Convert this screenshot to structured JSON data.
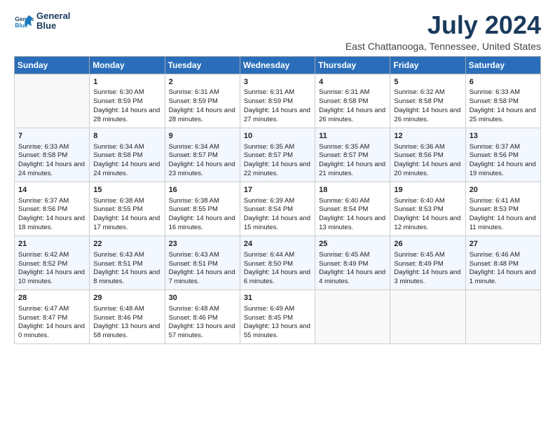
{
  "logo": {
    "line1": "General",
    "line2": "Blue"
  },
  "title": "July 2024",
  "subtitle": "East Chattanooga, Tennessee, United States",
  "days_of_week": [
    "Sunday",
    "Monday",
    "Tuesday",
    "Wednesday",
    "Thursday",
    "Friday",
    "Saturday"
  ],
  "weeks": [
    [
      {
        "num": "",
        "sunrise": "",
        "sunset": "",
        "daylight": "",
        "empty": true
      },
      {
        "num": "1",
        "sunrise": "Sunrise: 6:30 AM",
        "sunset": "Sunset: 8:59 PM",
        "daylight": "Daylight: 14 hours and 28 minutes."
      },
      {
        "num": "2",
        "sunrise": "Sunrise: 6:31 AM",
        "sunset": "Sunset: 8:59 PM",
        "daylight": "Daylight: 14 hours and 28 minutes."
      },
      {
        "num": "3",
        "sunrise": "Sunrise: 6:31 AM",
        "sunset": "Sunset: 8:59 PM",
        "daylight": "Daylight: 14 hours and 27 minutes."
      },
      {
        "num": "4",
        "sunrise": "Sunrise: 6:31 AM",
        "sunset": "Sunset: 8:58 PM",
        "daylight": "Daylight: 14 hours and 26 minutes."
      },
      {
        "num": "5",
        "sunrise": "Sunrise: 6:32 AM",
        "sunset": "Sunset: 8:58 PM",
        "daylight": "Daylight: 14 hours and 26 minutes."
      },
      {
        "num": "6",
        "sunrise": "Sunrise: 6:33 AM",
        "sunset": "Sunset: 8:58 PM",
        "daylight": "Daylight: 14 hours and 25 minutes."
      }
    ],
    [
      {
        "num": "7",
        "sunrise": "Sunrise: 6:33 AM",
        "sunset": "Sunset: 8:58 PM",
        "daylight": "Daylight: 14 hours and 24 minutes."
      },
      {
        "num": "8",
        "sunrise": "Sunrise: 6:34 AM",
        "sunset": "Sunset: 8:58 PM",
        "daylight": "Daylight: 14 hours and 24 minutes."
      },
      {
        "num": "9",
        "sunrise": "Sunrise: 6:34 AM",
        "sunset": "Sunset: 8:57 PM",
        "daylight": "Daylight: 14 hours and 23 minutes."
      },
      {
        "num": "10",
        "sunrise": "Sunrise: 6:35 AM",
        "sunset": "Sunset: 8:57 PM",
        "daylight": "Daylight: 14 hours and 22 minutes."
      },
      {
        "num": "11",
        "sunrise": "Sunrise: 6:35 AM",
        "sunset": "Sunset: 8:57 PM",
        "daylight": "Daylight: 14 hours and 21 minutes."
      },
      {
        "num": "12",
        "sunrise": "Sunrise: 6:36 AM",
        "sunset": "Sunset: 8:56 PM",
        "daylight": "Daylight: 14 hours and 20 minutes."
      },
      {
        "num": "13",
        "sunrise": "Sunrise: 6:37 AM",
        "sunset": "Sunset: 8:56 PM",
        "daylight": "Daylight: 14 hours and 19 minutes."
      }
    ],
    [
      {
        "num": "14",
        "sunrise": "Sunrise: 6:37 AM",
        "sunset": "Sunset: 8:56 PM",
        "daylight": "Daylight: 14 hours and 18 minutes."
      },
      {
        "num": "15",
        "sunrise": "Sunrise: 6:38 AM",
        "sunset": "Sunset: 8:55 PM",
        "daylight": "Daylight: 14 hours and 17 minutes."
      },
      {
        "num": "16",
        "sunrise": "Sunrise: 6:38 AM",
        "sunset": "Sunset: 8:55 PM",
        "daylight": "Daylight: 14 hours and 16 minutes."
      },
      {
        "num": "17",
        "sunrise": "Sunrise: 6:39 AM",
        "sunset": "Sunset: 8:54 PM",
        "daylight": "Daylight: 14 hours and 15 minutes."
      },
      {
        "num": "18",
        "sunrise": "Sunrise: 6:40 AM",
        "sunset": "Sunset: 8:54 PM",
        "daylight": "Daylight: 14 hours and 13 minutes."
      },
      {
        "num": "19",
        "sunrise": "Sunrise: 6:40 AM",
        "sunset": "Sunset: 8:53 PM",
        "daylight": "Daylight: 14 hours and 12 minutes."
      },
      {
        "num": "20",
        "sunrise": "Sunrise: 6:41 AM",
        "sunset": "Sunset: 8:53 PM",
        "daylight": "Daylight: 14 hours and 11 minutes."
      }
    ],
    [
      {
        "num": "21",
        "sunrise": "Sunrise: 6:42 AM",
        "sunset": "Sunset: 8:52 PM",
        "daylight": "Daylight: 14 hours and 10 minutes."
      },
      {
        "num": "22",
        "sunrise": "Sunrise: 6:43 AM",
        "sunset": "Sunset: 8:51 PM",
        "daylight": "Daylight: 14 hours and 8 minutes."
      },
      {
        "num": "23",
        "sunrise": "Sunrise: 6:43 AM",
        "sunset": "Sunset: 8:51 PM",
        "daylight": "Daylight: 14 hours and 7 minutes."
      },
      {
        "num": "24",
        "sunrise": "Sunrise: 6:44 AM",
        "sunset": "Sunset: 8:50 PM",
        "daylight": "Daylight: 14 hours and 6 minutes."
      },
      {
        "num": "25",
        "sunrise": "Sunrise: 6:45 AM",
        "sunset": "Sunset: 8:49 PM",
        "daylight": "Daylight: 14 hours and 4 minutes."
      },
      {
        "num": "26",
        "sunrise": "Sunrise: 6:45 AM",
        "sunset": "Sunset: 8:49 PM",
        "daylight": "Daylight: 14 hours and 3 minutes."
      },
      {
        "num": "27",
        "sunrise": "Sunrise: 6:46 AM",
        "sunset": "Sunset: 8:48 PM",
        "daylight": "Daylight: 14 hours and 1 minute."
      }
    ],
    [
      {
        "num": "28",
        "sunrise": "Sunrise: 6:47 AM",
        "sunset": "Sunset: 8:47 PM",
        "daylight": "Daylight: 14 hours and 0 minutes."
      },
      {
        "num": "29",
        "sunrise": "Sunrise: 6:48 AM",
        "sunset": "Sunset: 8:46 PM",
        "daylight": "Daylight: 13 hours and 58 minutes."
      },
      {
        "num": "30",
        "sunrise": "Sunrise: 6:48 AM",
        "sunset": "Sunset: 8:46 PM",
        "daylight": "Daylight: 13 hours and 57 minutes."
      },
      {
        "num": "31",
        "sunrise": "Sunrise: 6:49 AM",
        "sunset": "Sunset: 8:45 PM",
        "daylight": "Daylight: 13 hours and 55 minutes."
      },
      {
        "num": "",
        "sunrise": "",
        "sunset": "",
        "daylight": "",
        "empty": true
      },
      {
        "num": "",
        "sunrise": "",
        "sunset": "",
        "daylight": "",
        "empty": true
      },
      {
        "num": "",
        "sunrise": "",
        "sunset": "",
        "daylight": "",
        "empty": true
      }
    ]
  ]
}
